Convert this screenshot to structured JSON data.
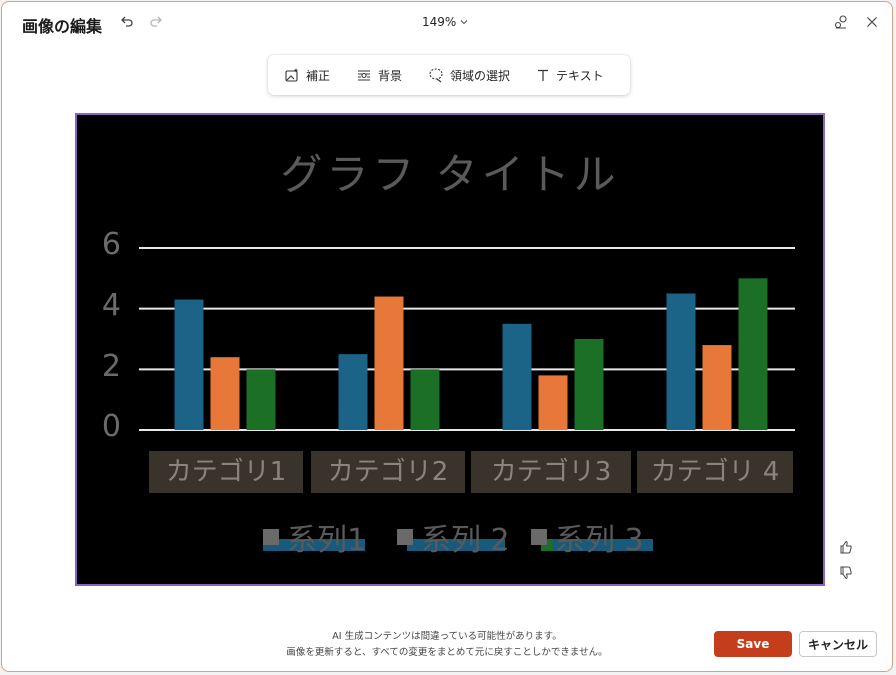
{
  "window": {
    "title": "画像の編集",
    "zoom_label": "149%",
    "icons": {
      "undo": "undo-icon",
      "redo": "redo-icon",
      "zoom_dropdown": "chevron-down-icon",
      "share": "share-icon",
      "close": "close-icon"
    }
  },
  "toolbar": {
    "items": [
      {
        "label": "補正",
        "icon": "adjust-image-icon"
      },
      {
        "label": "背景",
        "icon": "background-icon"
      },
      {
        "label": "領域の選択",
        "icon": "lasso-select-icon"
      },
      {
        "label": "テキスト",
        "icon": "text-icon"
      }
    ]
  },
  "image": {
    "chart_data": {
      "type": "bar",
      "title": "グラフ タイトル",
      "categories": [
        "カテゴリ1",
        "カテゴリ2",
        "カテゴリ3",
        "カテゴリ 4"
      ],
      "series": [
        {
          "name": "系列1",
          "values": [
            4.3,
            2.5,
            3.5,
            4.5
          ]
        },
        {
          "name": "系列 2",
          "values": [
            2.4,
            4.4,
            1.8,
            2.8
          ]
        },
        {
          "name": "系列 3",
          "values": [
            2.0,
            2.0,
            3.0,
            5.0
          ]
        }
      ],
      "yticks": [
        "6",
        "4",
        "2",
        "0"
      ],
      "ylim": [
        0,
        6
      ],
      "grid": true,
      "legend": "bottom",
      "colors": [
        "#1b6488",
        "#e8773a",
        "#1c7026"
      ]
    }
  },
  "feedback": {
    "like_icon": "thumbs-up-icon",
    "dislike_icon": "thumbs-down-icon"
  },
  "footer": {
    "disclaimer_line1": "AI 生成コンテンツは間違っている可能性があります。",
    "disclaimer_line2": "画像を更新すると、すべての変更をまとめて元に戻すことしかできません。",
    "save_label": "Save",
    "cancel_label": "キャンセル",
    "save_color": "#c43e1c"
  }
}
